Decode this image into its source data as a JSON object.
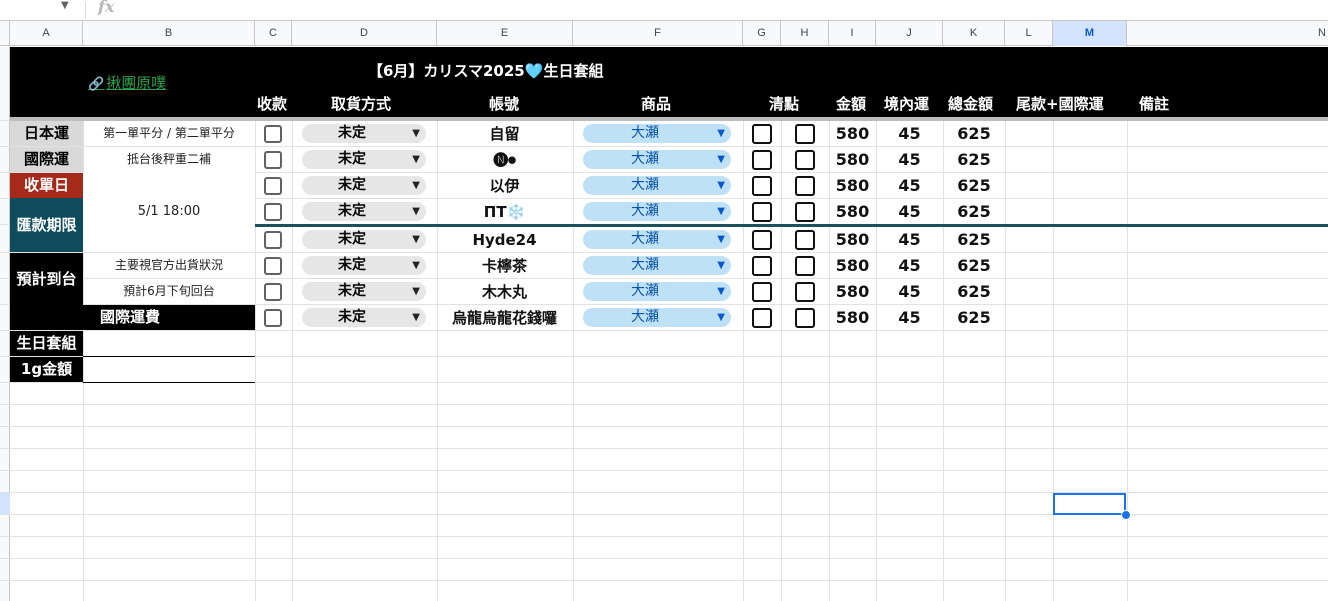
{
  "formula_bar": {
    "name_box": "゙",
    "fx": "fx",
    "formula": ""
  },
  "columns": [
    "A",
    "B",
    "C",
    "D",
    "E",
    "F",
    "G",
    "H",
    "I",
    "J",
    "K",
    "L",
    "M",
    "N"
  ],
  "selected_column": "M",
  "sheet": {
    "title": "【6月】カリスマ2025",
    "title_emoji": "🩵",
    "title_suffix": "生日套組",
    "link_text": "揪團原噗",
    "link_icon": "link-icon",
    "headers": {
      "payment": "收款",
      "delivery": "取貨方式",
      "account": "帳號",
      "product": "商品",
      "check": "清點",
      "amount": "金額",
      "domestic": "境內運",
      "total": "總金額",
      "balance": "尾款+國際運",
      "remarks": "備註"
    },
    "left_panel": {
      "japan_shipping": "日本運",
      "japan_shipping_note": "第一單平分 / 第二單平分",
      "intl_shipping": "國際運",
      "intl_shipping_note": "抵台後秤重二補",
      "order_close": "收單日",
      "payment_deadline": "匯款期限",
      "deadline_value": "5/1 18:00",
      "arrival": "預計到台",
      "arrival_note_1": "主要視官方出貨狀況",
      "arrival_note_2": "預計6月下旬回台",
      "intl_fee": "國際運費",
      "birthday_set": "生日套組",
      "per_gram": "1g金額"
    },
    "colors": {
      "order_close_bg": "#a52a1a",
      "payment_deadline_bg": "#0e4b5c",
      "label_gray_bg": "#d9d9d9",
      "band": "#000000",
      "delivery_chip": "#e6e6e6",
      "product_chip": "#bfe1f6",
      "divider": "#1d4f5d"
    },
    "rows": [
      {
        "delivery": "未定",
        "account": "自留",
        "product": "大瀬",
        "amount": "580",
        "domestic": "45",
        "total": "625"
      },
      {
        "delivery": "未定",
        "account": "🅝⏺",
        "product": "大瀬",
        "amount": "580",
        "domestic": "45",
        "total": "625"
      },
      {
        "delivery": "未定",
        "account": "以伊",
        "product": "大瀬",
        "amount": "580",
        "domestic": "45",
        "total": "625"
      },
      {
        "delivery": "未定",
        "account": "ΠΤ❄️",
        "product": "大瀬",
        "amount": "580",
        "domestic": "45",
        "total": "625"
      },
      {
        "delivery": "未定",
        "account": "Hyde24",
        "product": "大瀬",
        "amount": "580",
        "domestic": "45",
        "total": "625"
      },
      {
        "delivery": "未定",
        "account": "卡檸茶",
        "product": "大瀬",
        "amount": "580",
        "domestic": "45",
        "total": "625"
      },
      {
        "delivery": "未定",
        "account": "木木丸",
        "product": "大瀬",
        "amount": "580",
        "domestic": "45",
        "total": "625"
      },
      {
        "delivery": "未定",
        "account": "烏龍烏龍花錢囉",
        "product": "大瀬",
        "amount": "580",
        "domestic": "45",
        "total": "625"
      }
    ]
  }
}
